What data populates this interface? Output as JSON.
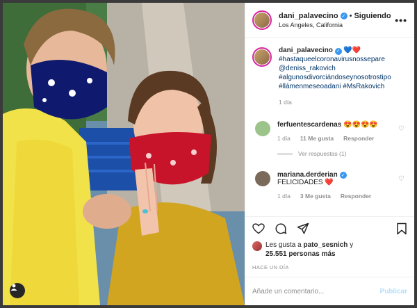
{
  "post": {
    "username": "dani_palavecino",
    "follow_separator": "•",
    "follow_label": "Siguiendo",
    "location": "Los Angeles, California",
    "more": "•••"
  },
  "caption": {
    "username": "dani_palavecino",
    "emoji": "💙❤️",
    "lines": [
      "#hastaqueelcoronavirusnossepare",
      "@deniss_rakovich",
      "#algunosdivorciándoseynosotrostipo",
      "#llámenmeseoadani #MsRakovich"
    ],
    "time": "1 día"
  },
  "comments": [
    {
      "username": "ferfuentescardenas",
      "text": "😍😍😍😍",
      "time": "1 día",
      "likes": "11 Me gusta",
      "reply": "Responder",
      "view_replies": "Ver respuestas (1)",
      "avatar_color": "#9cc48a"
    },
    {
      "username": "mariana.derderian",
      "text": "FELICIDADES ❤️",
      "time": "1 día",
      "likes": "3 Me gusta",
      "reply": "Responder",
      "avatar_color": "#7a6a5a"
    }
  ],
  "likes": {
    "prefix": "Les gusta a",
    "user": "pato_sesnich",
    "conj": "y",
    "count": "25.551 personas más"
  },
  "posted_ago": "HACE UN DÍA",
  "add_comment": {
    "placeholder": "Añade un comentario...",
    "publish": "Publicar"
  },
  "icons": {
    "like": "heart-icon",
    "comment": "comment-icon",
    "share": "paper-plane-icon",
    "save": "bookmark-icon",
    "tag": "user-tag-icon"
  },
  "colors": {
    "link": "#003569",
    "verified": "#3897f0",
    "publish_disabled": "#b2dffc",
    "mask_blue": "#0f1a6e",
    "mask_red": "#c8142a"
  }
}
